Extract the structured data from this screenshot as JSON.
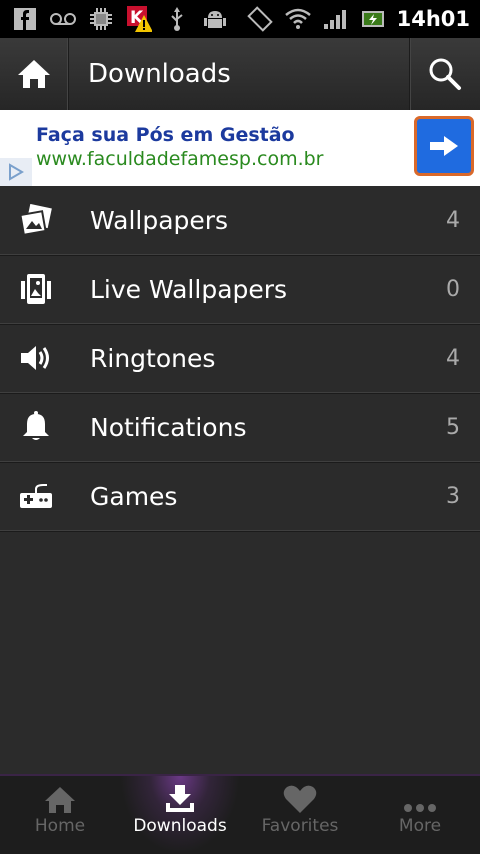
{
  "status_bar": {
    "time": "14h01"
  },
  "action_bar": {
    "title": "Downloads"
  },
  "ad": {
    "title": "Faça sua Pós em Gestão",
    "url": "www.faculdadefamesp.com.br"
  },
  "categories": [
    {
      "label": "Wallpapers",
      "count": "4",
      "icon": "wallpapers-icon"
    },
    {
      "label": "Live Wallpapers",
      "count": "0",
      "icon": "live-wallpapers-icon"
    },
    {
      "label": "Ringtones",
      "count": "4",
      "icon": "speaker-icon"
    },
    {
      "label": "Notifications",
      "count": "5",
      "icon": "bell-icon"
    },
    {
      "label": "Games",
      "count": "3",
      "icon": "gamepad-icon"
    }
  ],
  "tabs": [
    {
      "label": "Home",
      "icon": "home-icon",
      "active": false
    },
    {
      "label": "Downloads",
      "icon": "download-icon",
      "active": true
    },
    {
      "label": "Favorites",
      "icon": "heart-icon",
      "active": false
    },
    {
      "label": "More",
      "icon": "more-icon",
      "active": false
    }
  ],
  "colors": {
    "accent": "#9b4fd1",
    "ad_title": "#1c3a9e",
    "ad_url": "#2a8a1f",
    "ad_button": "#1f6be0"
  }
}
